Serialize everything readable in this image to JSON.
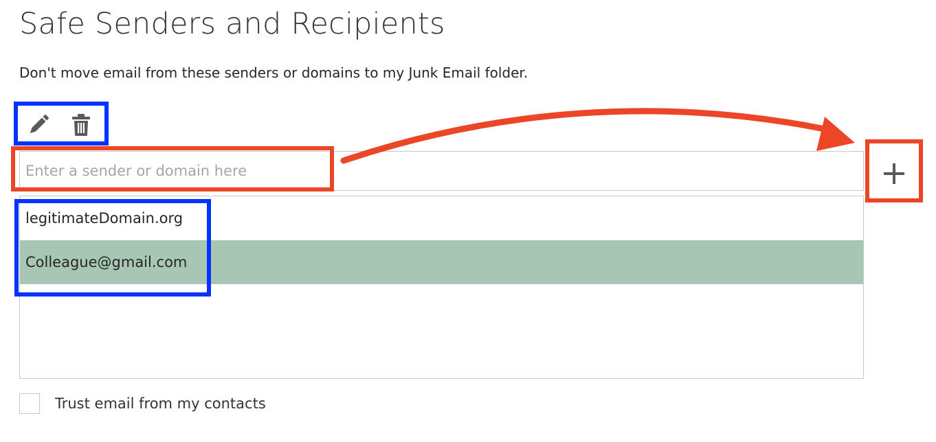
{
  "header": {
    "title": "Safe Senders and Recipients",
    "description": "Don't move email from these senders or domains to my Junk Email folder."
  },
  "toolbar": {
    "edit_icon": "pencil-icon",
    "delete_icon": "trash-icon"
  },
  "entry": {
    "placeholder": "Enter a sender or domain here",
    "value": "",
    "add_icon": "plus-icon"
  },
  "safe_list": {
    "items": [
      {
        "label": "legitimateDomain.org",
        "selected": false
      },
      {
        "label": "Colleague@gmail.com",
        "selected": true
      }
    ]
  },
  "trust_contacts": {
    "label": "Trust email from my contacts",
    "checked": false
  },
  "annotations": {
    "highlight_blue": "#0433ff",
    "highlight_red": "#ec4628",
    "arrow_color": "#ec4628"
  },
  "colors": {
    "selected_row": "#a8c6b4",
    "border": "#c8c8c8",
    "icon": "#595959"
  }
}
